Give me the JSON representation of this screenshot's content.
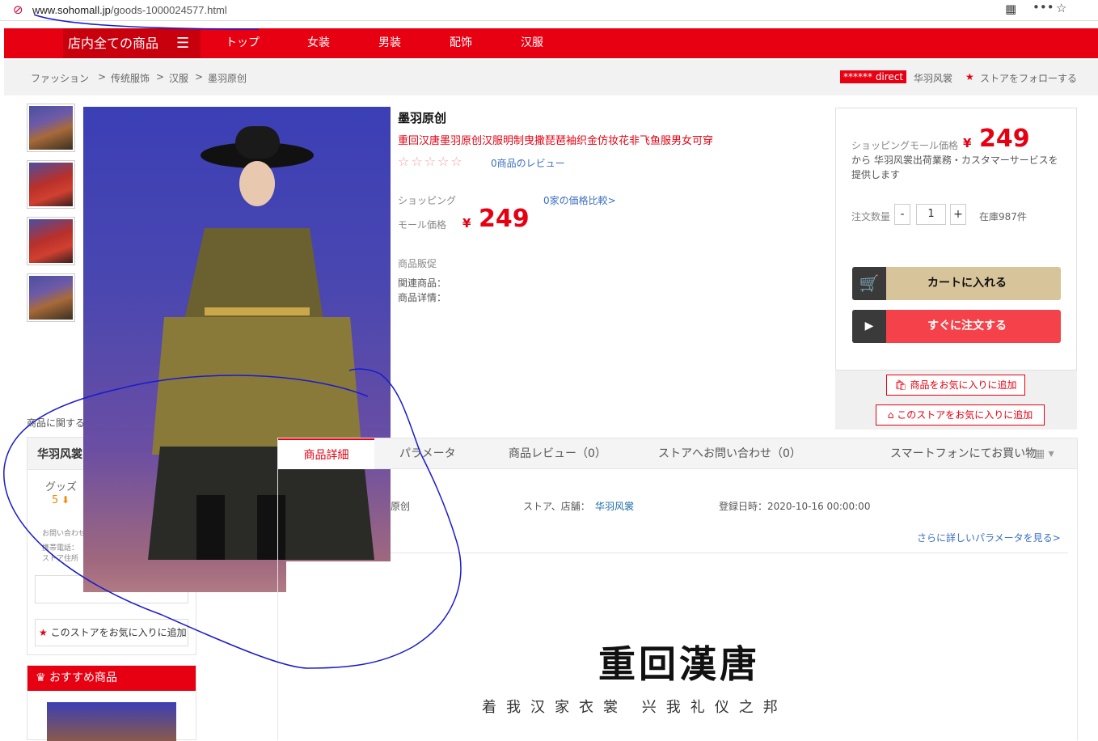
{
  "browser": {
    "url_domain": "www.sohomall.jp",
    "url_path": "/goods-1000024577.html"
  },
  "nav": {
    "category_label": "店内全ての商品",
    "items": [
      "トップ",
      "女装",
      "男装",
      "配饰",
      "汉服"
    ]
  },
  "breadcrumb": [
    "ファッション",
    ">",
    "传统服饰",
    ">",
    "汉服",
    ">",
    "墨羽原创"
  ],
  "store_header": {
    "badge": "****** direct",
    "store_name": "华羽风裳",
    "follow_label": "ストアをフォローする"
  },
  "product": {
    "title": "墨羽原创",
    "subtitle": "重回汉唐墨羽原创汉服明制曳撒琵琶袖织金仿妆花非飞鱼服男女可穿",
    "stars": "☆☆☆☆☆",
    "review_link": "0商品のレビュー",
    "price_label_1": "ショッピング",
    "price_label_2": "モール価格",
    "compare_link": "0家の価格比較>",
    "currency": "¥",
    "price": "249",
    "promo_label": "商品販促",
    "related_label": "関連商品：",
    "detail_label": "商品详情："
  },
  "buybox": {
    "price_label": "ショッピングモール価格",
    "currency": "¥",
    "price": "249",
    "provider_text": "から 华羽风裳出荷業務・カスタマーサービスを提供します",
    "qty_label": "注文数量",
    "minus": "-",
    "qty": "1",
    "plus": "+",
    "stock": "在庫987件",
    "cart_label": "カートに入れる",
    "order_label": "すぐに注文する",
    "fav_item_label": "商品をお気に入りに追加",
    "fav_store_label": "このストアをお気に入りに追加"
  },
  "left": {
    "related_caption": "商品に関する",
    "store_name": "华羽风裳",
    "goods_label": "グッズ",
    "goods_score": "5",
    "info_1": "お問い合わせ",
    "info_2": "携帯電話：",
    "info_3": "ストア住所",
    "fav_store_label": "このストアをお気に入りに追加",
    "recommend_label": "おすすめ商品"
  },
  "tabs": {
    "items": [
      "商品詳細",
      "パラメータ",
      "商品レビュー（0）",
      "ストアへお問い合わせ（0）"
    ],
    "mobile_label": "スマートフォンにてお買い物"
  },
  "params": {
    "brand_fragment": "原创",
    "store_label": "ストア、店舗：",
    "store_value": "华羽风裳",
    "reg_label": "登録日時：2020-10-16 00:00:00",
    "more_link": "さらに詳しいパラメータを見る>"
  },
  "banner": {
    "logo": "重回漢唐",
    "slogan": "着我汉家衣裳  兴我礼仪之邦"
  }
}
